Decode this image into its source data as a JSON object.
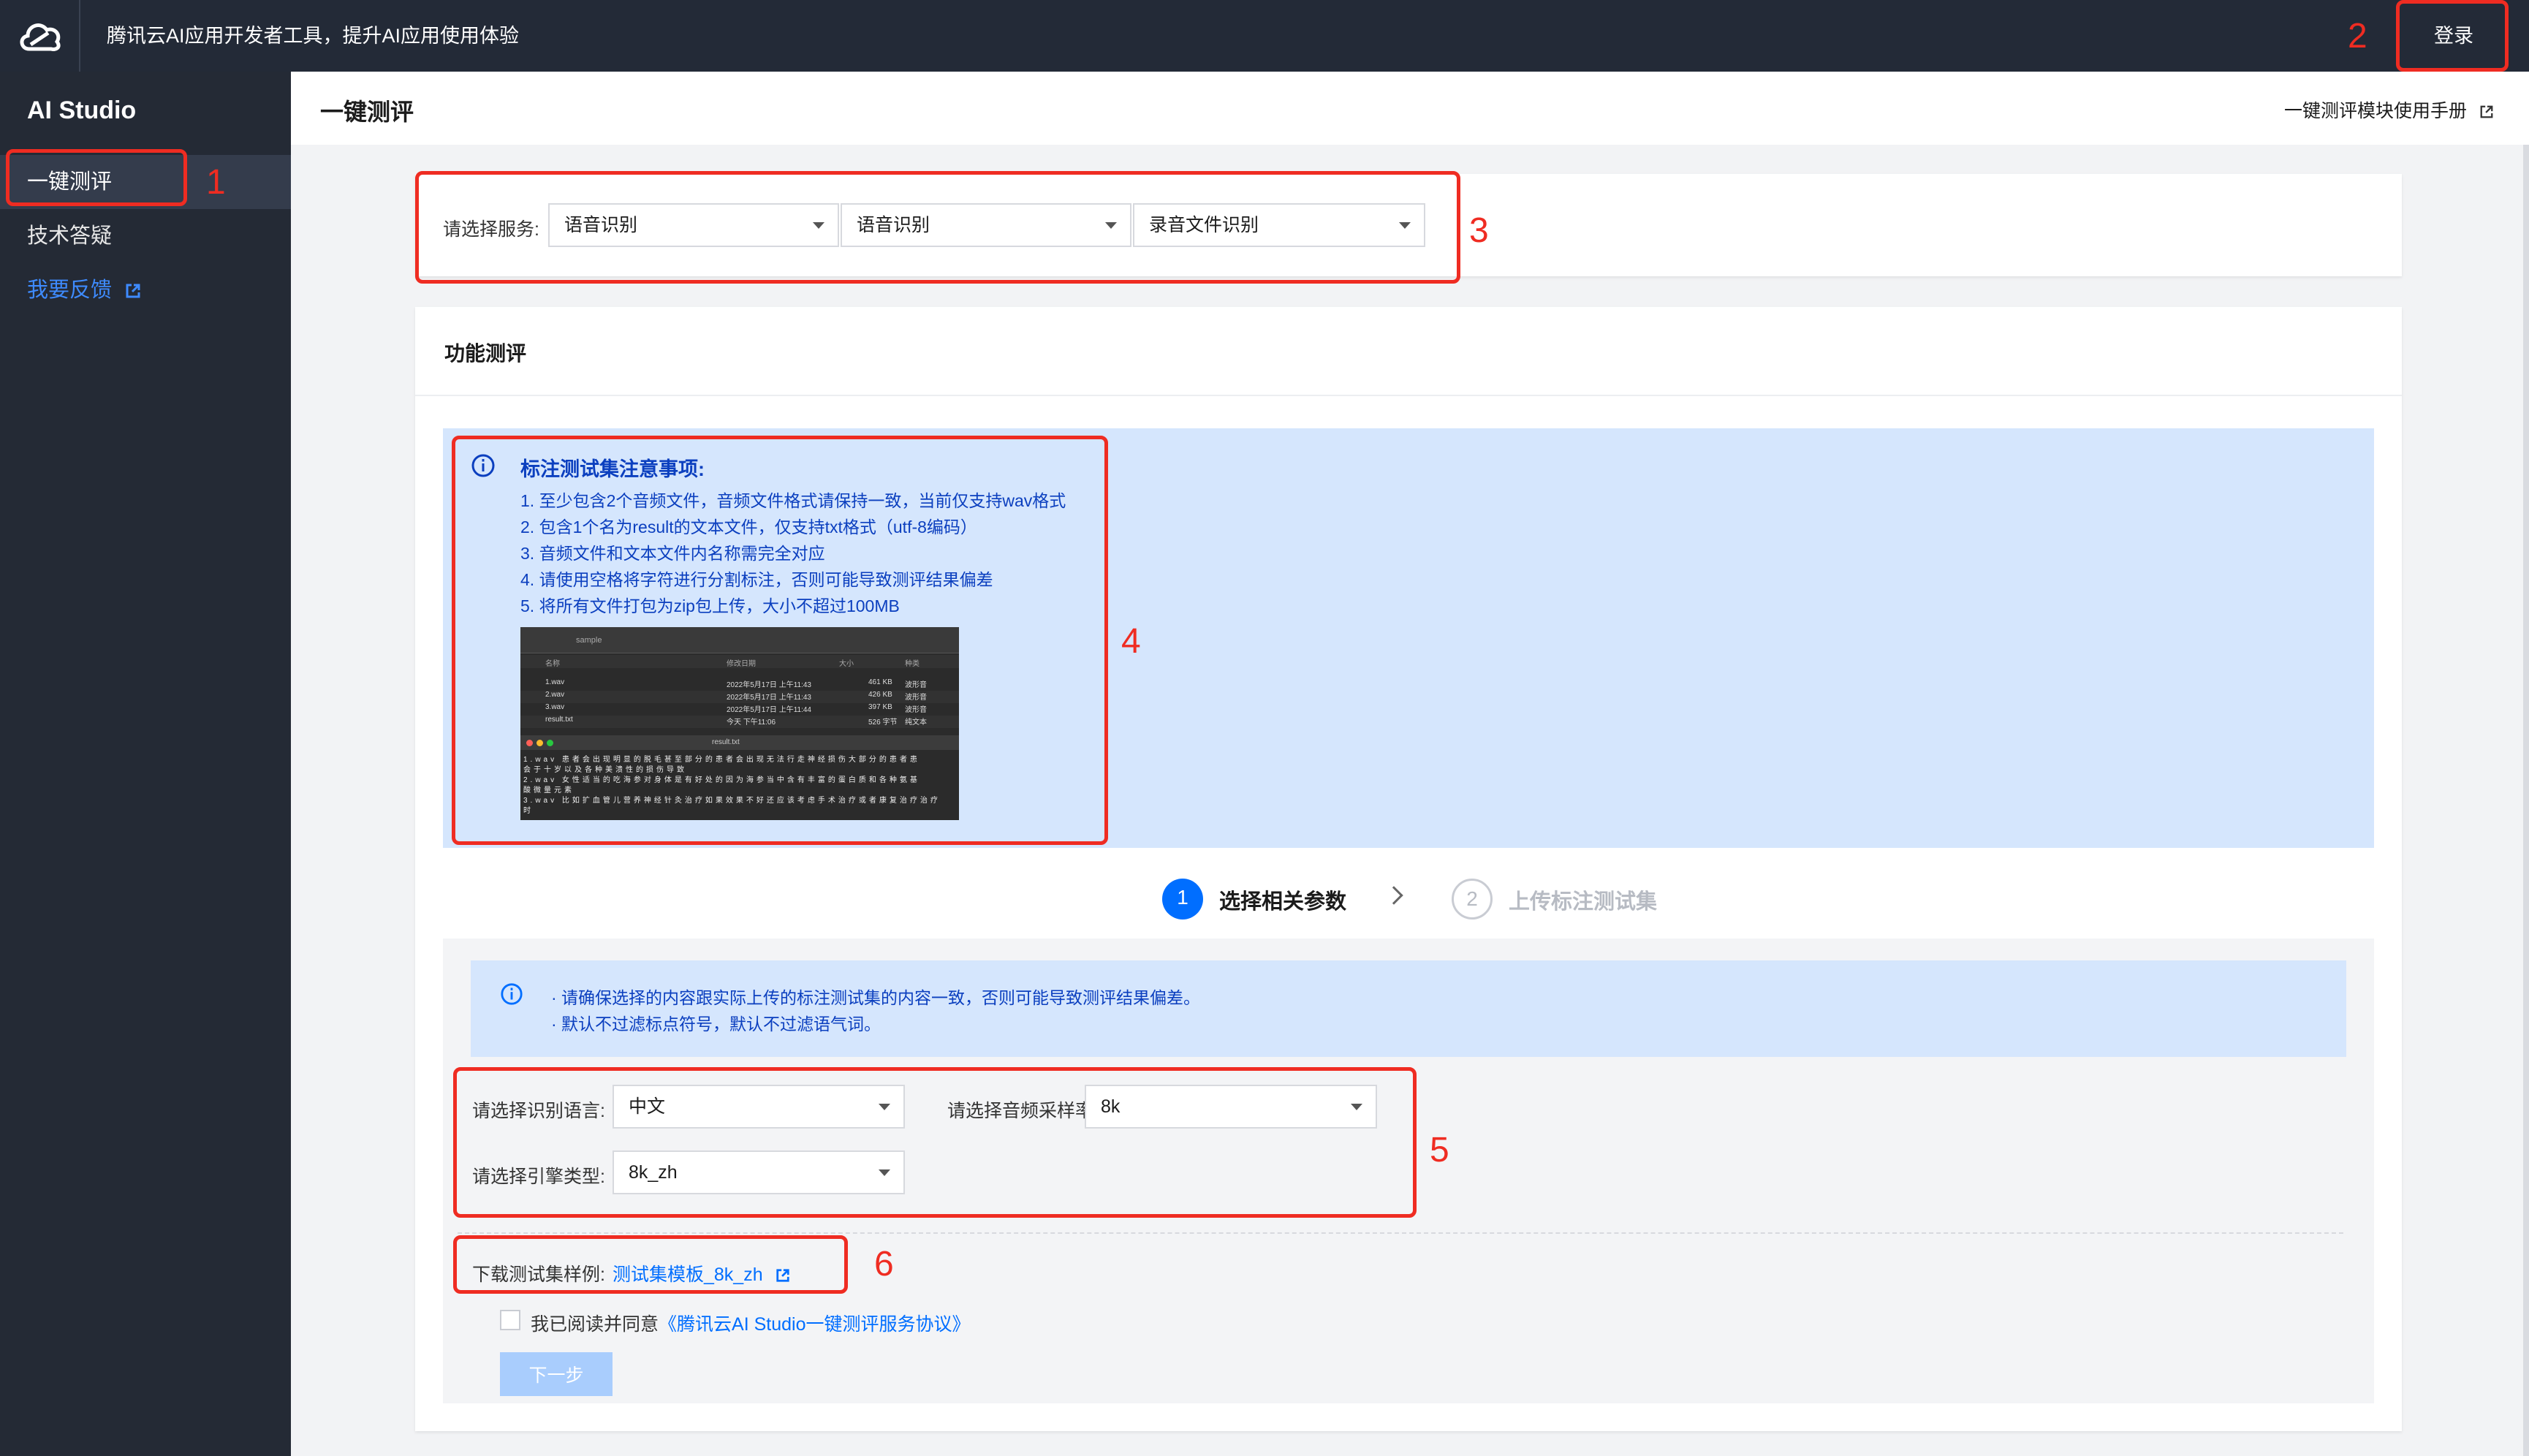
{
  "topbar": {
    "slogan": "腾讯云AI应用开发者工具，提升AI应用使用体验",
    "login_label": "登录"
  },
  "sidebar": {
    "brand": "AI Studio",
    "items": [
      {
        "label": "一键测评"
      },
      {
        "label": "技术答疑"
      },
      {
        "label": "我要反馈"
      }
    ]
  },
  "header": {
    "title": "一键测评",
    "manual_link": "一键测评模块使用手册"
  },
  "service": {
    "label": "请选择服务:",
    "selects": [
      "语音识别",
      "语音识别",
      "录音文件识别"
    ]
  },
  "main": {
    "section_title": "功能测评",
    "notice": {
      "title": "标注测试集注意事项:",
      "lines": [
        "1. 至少包含2个音频文件，音频文件格式请保持一致，当前仅支持wav格式",
        "2. 包含1个名为result的文本文件，仅支持txt格式（utf-8编码）",
        "3. 音频文件和文本文件内名称需完全对应",
        "4. 请使用空格将字符进行分割标注，否则可能导致测评结果偏差",
        "5. 将所有文件打包为zip包上传，大小不超过100MB"
      ]
    },
    "preview": {
      "folder": "sample",
      "columns": [
        "名称",
        "修改日期",
        "大小",
        "种类"
      ],
      "files": [
        {
          "name": "1.wav",
          "date": "2022年5月17日 上午11:43",
          "size": "461 KB",
          "kind": "波形音"
        },
        {
          "name": "2.wav",
          "date": "2022年5月17日 上午11:43",
          "size": "426 KB",
          "kind": "波形音"
        },
        {
          "name": "3.wav",
          "date": "2022年5月17日 上午11:44",
          "size": "397 KB",
          "kind": "波形音"
        },
        {
          "name": "result.txt",
          "date": "今天 下午11:06",
          "size": "526 字节",
          "kind": "纯文本"
        }
      ],
      "text_title": "result.txt",
      "text_lines": [
        "1.wav  患者会出现明显的脱毛甚至部分的患者会出现无法行走神经损伤大部分的患者患",
        "会于十岁以及各种美溃性的损伤导致",
        "2.wav  女性适当的吃海参对身体是有好处的因为海参当中含有丰富的蛋白质和各种氨基",
        "酸微量元素",
        "3.wav  比如扩血管儿营养神经针灸治疗如果效果不好还应该考虑手术治疗或者康复治疗治疗",
        "时"
      ]
    },
    "steps": [
      {
        "number": "1",
        "label": "选择相关参数"
      },
      {
        "number": "2",
        "label": "上传标注测试集"
      }
    ],
    "param_notice": [
      "· 请确保选择的内容跟实际上传的标注测试集的内容一致，否则可能导致测评结果偏差。",
      "· 默认不过滤标点符号，默认不过滤语气词。"
    ],
    "params": {
      "language_label": "请选择识别语言:",
      "language_value": "中文",
      "sample_rate_label": "请选择音频采样率:",
      "sample_rate_value": "8k",
      "engine_label": "请选择引擎类型:",
      "engine_value": "8k_zh"
    },
    "download": {
      "label": "下载测试集样例:",
      "link": "测试集模板_8k_zh"
    },
    "agreement": {
      "prefix": "我已阅读并同意",
      "link": "《腾讯云AI Studio一键测评服务协议》"
    },
    "next_label": "下一步"
  },
  "annotations": [
    "1",
    "2",
    "3",
    "4",
    "5",
    "6"
  ],
  "colors": {
    "topbar": "#232a37",
    "sidebar": "#242a35",
    "accent": "#006eff",
    "annotation": "#ef2c22",
    "notice_bg": "#d5e6fd"
  }
}
